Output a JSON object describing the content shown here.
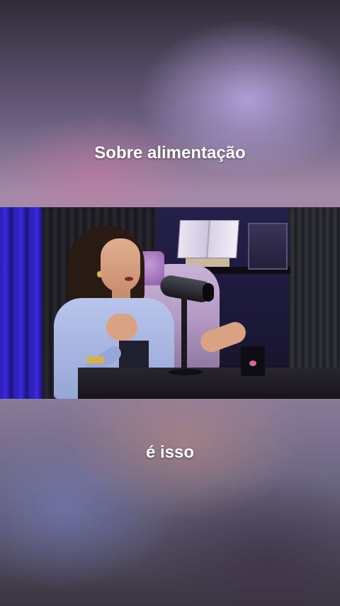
{
  "captions": {
    "top": "Sobre alimentação",
    "bottom": "é isso"
  },
  "colors": {
    "caption_text": "#ffffff",
    "curtain_accent": "#3a2ae0"
  },
  "icons": [
    "microphone"
  ]
}
